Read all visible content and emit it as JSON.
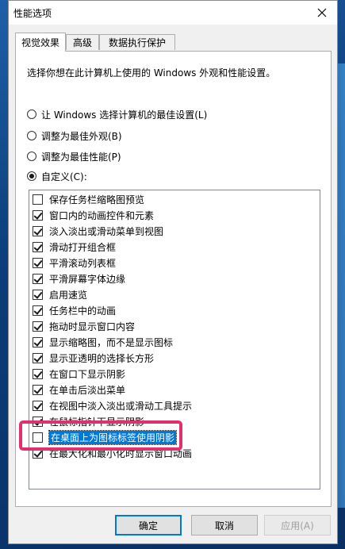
{
  "window": {
    "title": "性能选项"
  },
  "tabs": [
    {
      "label": "视觉效果"
    },
    {
      "label": "高级"
    },
    {
      "label": "数据执行保护"
    }
  ],
  "description": "选择你想在此计算机上使用的 Windows 外观和性能设置。",
  "radios": [
    {
      "label": "让 Windows 选择计算机的最佳设置(L)",
      "checked": false
    },
    {
      "label": "调整为最佳外观(B)",
      "checked": false
    },
    {
      "label": "调整为最佳性能(P)",
      "checked": false
    },
    {
      "label": "自定义(C):",
      "checked": true
    }
  ],
  "options": [
    {
      "label": "保存任务栏缩略图预览",
      "checked": false
    },
    {
      "label": "窗口内的动画控件和元素",
      "checked": true
    },
    {
      "label": "淡入淡出或滑动菜单到视图",
      "checked": true
    },
    {
      "label": "滑动打开组合框",
      "checked": true
    },
    {
      "label": "平滑滚动列表框",
      "checked": true
    },
    {
      "label": "平滑屏幕字体边缘",
      "checked": true
    },
    {
      "label": "启用速览",
      "checked": true
    },
    {
      "label": "任务栏中的动画",
      "checked": true
    },
    {
      "label": "拖动时显示窗口内容",
      "checked": true
    },
    {
      "label": "显示缩略图，而不是显示图标",
      "checked": true
    },
    {
      "label": "显示亚透明的选择长方形",
      "checked": true
    },
    {
      "label": "在窗口下显示阴影",
      "checked": true
    },
    {
      "label": "在单击后淡出菜单",
      "checked": true
    },
    {
      "label": "在视图中淡入淡出或滑动工具提示",
      "checked": true
    },
    {
      "label": "在鼠标指针下显示阴影",
      "checked": true
    },
    {
      "label": "在桌面上为图标标签使用阴影",
      "checked": false,
      "selected": true
    },
    {
      "label": "在最大化和最小化时显示窗口动画",
      "checked": true
    }
  ],
  "buttons": {
    "ok": "确定",
    "cancel": "取消",
    "apply": "应用(A)"
  }
}
